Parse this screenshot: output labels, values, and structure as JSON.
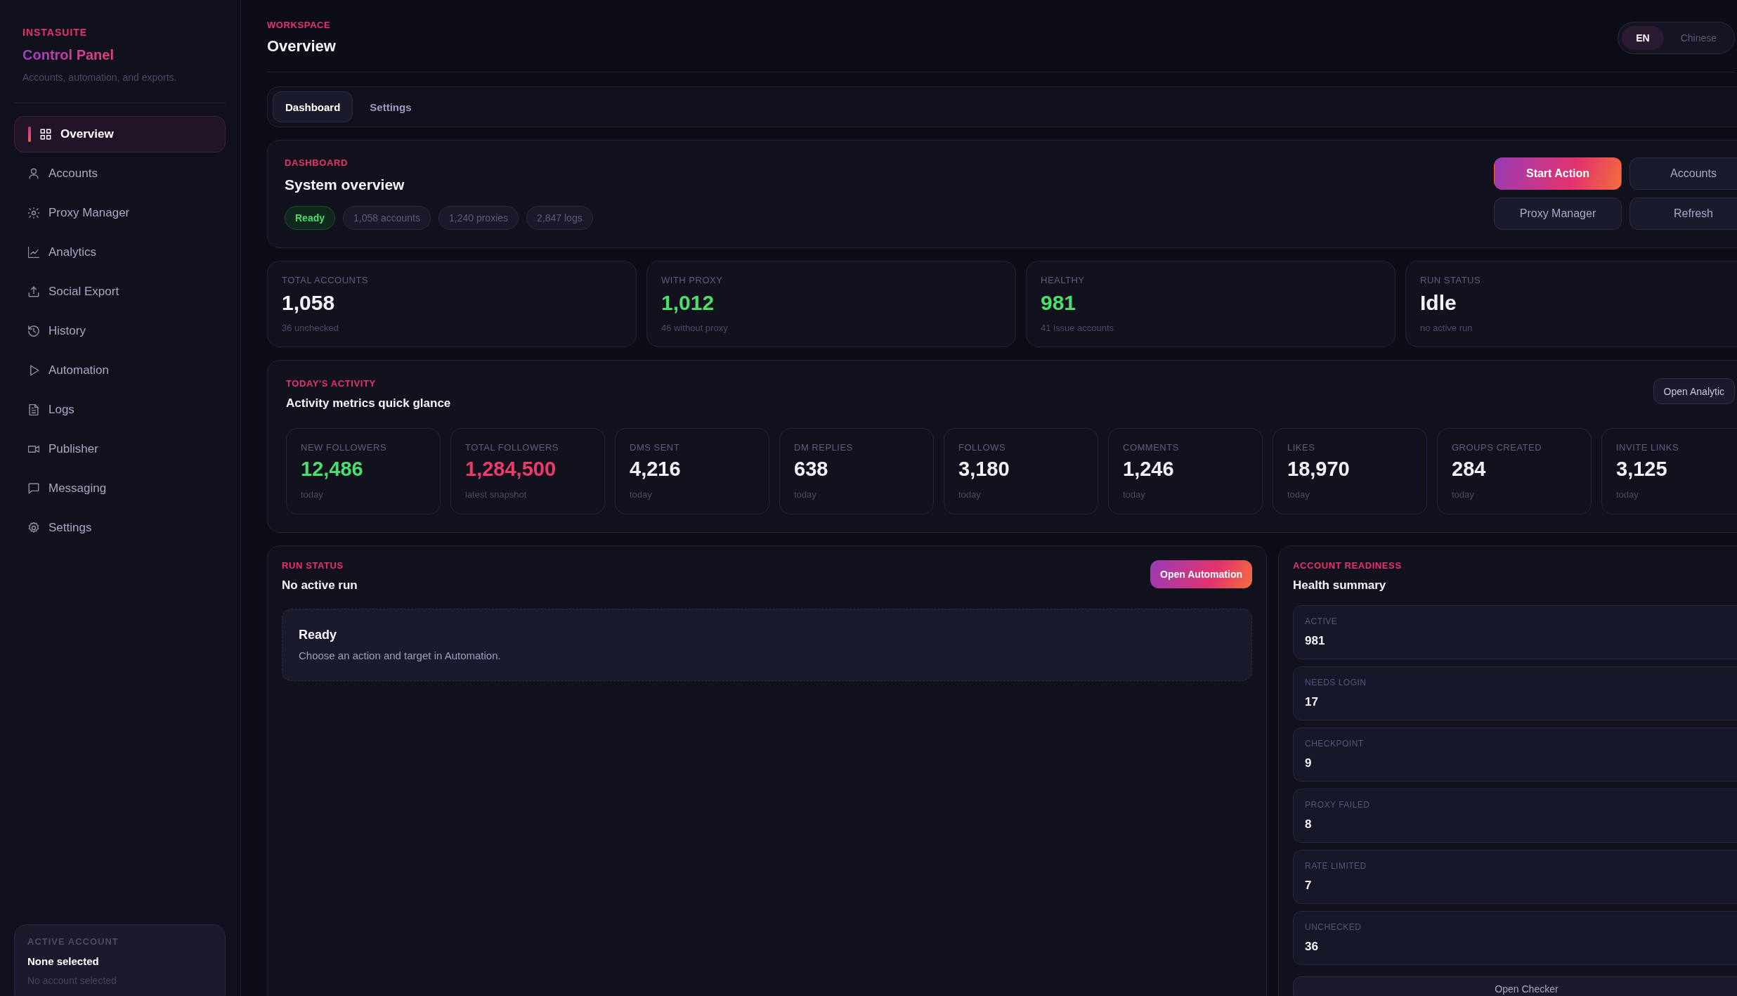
{
  "sidebar": {
    "brand": "INSTASUITE",
    "title": "Control Panel",
    "subtitle": "Accounts, automation, and exports.",
    "nav": [
      {
        "label": "Overview",
        "selected": true
      },
      {
        "label": "Accounts",
        "selected": false
      },
      {
        "label": "Proxy Manager",
        "selected": false
      },
      {
        "label": "Analytics",
        "selected": false
      },
      {
        "label": "Social Export",
        "selected": false
      },
      {
        "label": "History",
        "selected": false
      },
      {
        "label": "Automation",
        "selected": false
      },
      {
        "label": "Logs",
        "selected": false
      },
      {
        "label": "Publisher",
        "selected": false
      },
      {
        "label": "Messaging",
        "selected": false
      },
      {
        "label": "Settings",
        "selected": false
      }
    ],
    "active_account": {
      "label": "ACTIVE ACCOUNT",
      "name": "None selected",
      "detail": "No account selected"
    }
  },
  "header": {
    "eyebrow": "WORKSPACE",
    "title": "Overview",
    "languages": [
      {
        "label": "EN",
        "selected": true
      },
      {
        "label": "Chinese",
        "selected": false
      }
    ]
  },
  "tabs": [
    {
      "label": "Dashboard",
      "selected": true
    },
    {
      "label": "Settings",
      "selected": false
    }
  ],
  "dashboard": {
    "eyebrow": "DASHBOARD",
    "title": "System overview",
    "chips": [
      {
        "label": "Ready",
        "kind": "status"
      },
      {
        "label": "1,058 accounts",
        "kind": "count"
      },
      {
        "label": "1,240 proxies",
        "kind": "count"
      },
      {
        "label": "2,847 logs",
        "kind": "count"
      }
    ],
    "actions": [
      {
        "label": "Start Action",
        "kind": "primary"
      },
      {
        "label": "Accounts",
        "kind": "secondary"
      },
      {
        "label": "Proxy Manager",
        "kind": "secondary"
      },
      {
        "label": "Refresh",
        "kind": "secondary"
      }
    ]
  },
  "stats": [
    {
      "label": "TOTAL ACCOUNTS",
      "value": "1,058",
      "note": "36 unchecked",
      "color": "#f2f2f8"
    },
    {
      "label": "WITH PROXY",
      "value": "1,012",
      "note": "46 without proxy",
      "color": "#4ade6a"
    },
    {
      "label": "HEALTHY",
      "value": "981",
      "note": "41 issue accounts",
      "color": "#4ade6a"
    },
    {
      "label": "RUN STATUS",
      "value": "Idle",
      "note": "no active run",
      "color": "#f2f2f8"
    }
  ],
  "activity": {
    "eyebrow": "TODAY'S ACTIVITY",
    "title": "Activity metrics quick glance",
    "action": "Open Analytic",
    "metrics": [
      {
        "label": "NEW FOLLOWERS",
        "value": "12,486",
        "note": "today",
        "color": "#4ade6a"
      },
      {
        "label": "TOTAL FOLLOWERS",
        "value": "1,284,500",
        "note": "latest snapshot",
        "color": "#ee3a6a"
      },
      {
        "label": "DMS SENT",
        "value": "4,216",
        "note": "today",
        "color": "#f2f2f8"
      },
      {
        "label": "DM REPLIES",
        "value": "638",
        "note": "today",
        "color": "#f2f2f8"
      },
      {
        "label": "FOLLOWS",
        "value": "3,180",
        "note": "today",
        "color": "#f2f2f8"
      },
      {
        "label": "COMMENTS",
        "value": "1,246",
        "note": "today",
        "color": "#f2f2f8"
      },
      {
        "label": "LIKES",
        "value": "18,970",
        "note": "today",
        "color": "#f2f2f8"
      },
      {
        "label": "GROUPS CREATED",
        "value": "284",
        "note": "today",
        "color": "#f2f2f8"
      },
      {
        "label": "INVITE LINKS",
        "value": "3,125",
        "note": "today",
        "color": "#f2f2f8"
      }
    ]
  },
  "run_status": {
    "eyebrow": "RUN STATUS",
    "title": "No active run",
    "action": "Open Automation",
    "message": {
      "title": "Ready",
      "text": "Choose an action and target in Automation."
    }
  },
  "readiness": {
    "eyebrow": "ACCOUNT READINESS",
    "title": "Health summary",
    "rows": [
      {
        "label": "ACTIVE",
        "value": "981"
      },
      {
        "label": "NEEDS LOGIN",
        "value": "17"
      },
      {
        "label": "CHECKPOINT",
        "value": "9"
      },
      {
        "label": "PROXY FAILED",
        "value": "8"
      },
      {
        "label": "RATE LIMITED",
        "value": "7"
      },
      {
        "label": "UNCHECKED",
        "value": "36"
      }
    ],
    "action": "Open Checker"
  }
}
